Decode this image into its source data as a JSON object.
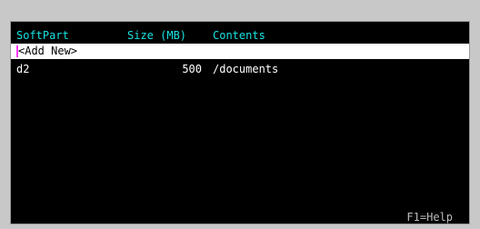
{
  "columns": {
    "name": "SoftPart",
    "size": "Size (MB)",
    "contents": "Contents"
  },
  "add_new_label": "<Add New>",
  "rows": [
    {
      "name": "d2",
      "size": "500",
      "contents": "/documents"
    }
  ],
  "footer_text": "F1=Help",
  "colors": {
    "header_text": "#19e3e3",
    "background": "#000000",
    "selection_bg": "#ffffff",
    "cursor": "#ff39ff"
  }
}
